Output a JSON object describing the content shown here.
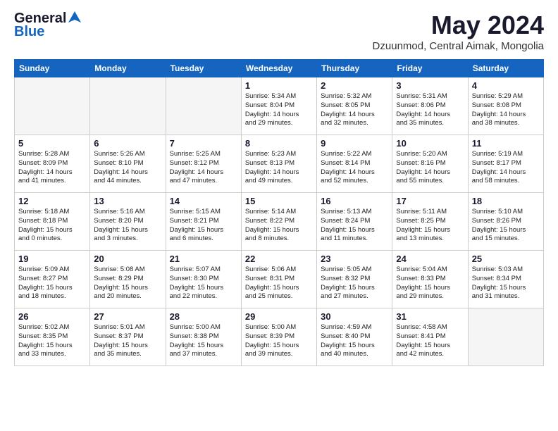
{
  "header": {
    "logo_general": "General",
    "logo_blue": "Blue",
    "month": "May 2024",
    "location": "Dzuunmod, Central Aimak, Mongolia"
  },
  "days_of_week": [
    "Sunday",
    "Monday",
    "Tuesday",
    "Wednesday",
    "Thursday",
    "Friday",
    "Saturday"
  ],
  "weeks": [
    [
      {
        "date": "",
        "info": ""
      },
      {
        "date": "",
        "info": ""
      },
      {
        "date": "",
        "info": ""
      },
      {
        "date": "1",
        "info": "Sunrise: 5:34 AM\nSunset: 8:04 PM\nDaylight: 14 hours\nand 29 minutes."
      },
      {
        "date": "2",
        "info": "Sunrise: 5:32 AM\nSunset: 8:05 PM\nDaylight: 14 hours\nand 32 minutes."
      },
      {
        "date": "3",
        "info": "Sunrise: 5:31 AM\nSunset: 8:06 PM\nDaylight: 14 hours\nand 35 minutes."
      },
      {
        "date": "4",
        "info": "Sunrise: 5:29 AM\nSunset: 8:08 PM\nDaylight: 14 hours\nand 38 minutes."
      }
    ],
    [
      {
        "date": "5",
        "info": "Sunrise: 5:28 AM\nSunset: 8:09 PM\nDaylight: 14 hours\nand 41 minutes."
      },
      {
        "date": "6",
        "info": "Sunrise: 5:26 AM\nSunset: 8:10 PM\nDaylight: 14 hours\nand 44 minutes."
      },
      {
        "date": "7",
        "info": "Sunrise: 5:25 AM\nSunset: 8:12 PM\nDaylight: 14 hours\nand 47 minutes."
      },
      {
        "date": "8",
        "info": "Sunrise: 5:23 AM\nSunset: 8:13 PM\nDaylight: 14 hours\nand 49 minutes."
      },
      {
        "date": "9",
        "info": "Sunrise: 5:22 AM\nSunset: 8:14 PM\nDaylight: 14 hours\nand 52 minutes."
      },
      {
        "date": "10",
        "info": "Sunrise: 5:20 AM\nSunset: 8:16 PM\nDaylight: 14 hours\nand 55 minutes."
      },
      {
        "date": "11",
        "info": "Sunrise: 5:19 AM\nSunset: 8:17 PM\nDaylight: 14 hours\nand 58 minutes."
      }
    ],
    [
      {
        "date": "12",
        "info": "Sunrise: 5:18 AM\nSunset: 8:18 PM\nDaylight: 15 hours\nand 0 minutes."
      },
      {
        "date": "13",
        "info": "Sunrise: 5:16 AM\nSunset: 8:20 PM\nDaylight: 15 hours\nand 3 minutes."
      },
      {
        "date": "14",
        "info": "Sunrise: 5:15 AM\nSunset: 8:21 PM\nDaylight: 15 hours\nand 6 minutes."
      },
      {
        "date": "15",
        "info": "Sunrise: 5:14 AM\nSunset: 8:22 PM\nDaylight: 15 hours\nand 8 minutes."
      },
      {
        "date": "16",
        "info": "Sunrise: 5:13 AM\nSunset: 8:24 PM\nDaylight: 15 hours\nand 11 minutes."
      },
      {
        "date": "17",
        "info": "Sunrise: 5:11 AM\nSunset: 8:25 PM\nDaylight: 15 hours\nand 13 minutes."
      },
      {
        "date": "18",
        "info": "Sunrise: 5:10 AM\nSunset: 8:26 PM\nDaylight: 15 hours\nand 15 minutes."
      }
    ],
    [
      {
        "date": "19",
        "info": "Sunrise: 5:09 AM\nSunset: 8:27 PM\nDaylight: 15 hours\nand 18 minutes."
      },
      {
        "date": "20",
        "info": "Sunrise: 5:08 AM\nSunset: 8:29 PM\nDaylight: 15 hours\nand 20 minutes."
      },
      {
        "date": "21",
        "info": "Sunrise: 5:07 AM\nSunset: 8:30 PM\nDaylight: 15 hours\nand 22 minutes."
      },
      {
        "date": "22",
        "info": "Sunrise: 5:06 AM\nSunset: 8:31 PM\nDaylight: 15 hours\nand 25 minutes."
      },
      {
        "date": "23",
        "info": "Sunrise: 5:05 AM\nSunset: 8:32 PM\nDaylight: 15 hours\nand 27 minutes."
      },
      {
        "date": "24",
        "info": "Sunrise: 5:04 AM\nSunset: 8:33 PM\nDaylight: 15 hours\nand 29 minutes."
      },
      {
        "date": "25",
        "info": "Sunrise: 5:03 AM\nSunset: 8:34 PM\nDaylight: 15 hours\nand 31 minutes."
      }
    ],
    [
      {
        "date": "26",
        "info": "Sunrise: 5:02 AM\nSunset: 8:35 PM\nDaylight: 15 hours\nand 33 minutes."
      },
      {
        "date": "27",
        "info": "Sunrise: 5:01 AM\nSunset: 8:37 PM\nDaylight: 15 hours\nand 35 minutes."
      },
      {
        "date": "28",
        "info": "Sunrise: 5:00 AM\nSunset: 8:38 PM\nDaylight: 15 hours\nand 37 minutes."
      },
      {
        "date": "29",
        "info": "Sunrise: 5:00 AM\nSunset: 8:39 PM\nDaylight: 15 hours\nand 39 minutes."
      },
      {
        "date": "30",
        "info": "Sunrise: 4:59 AM\nSunset: 8:40 PM\nDaylight: 15 hours\nand 40 minutes."
      },
      {
        "date": "31",
        "info": "Sunrise: 4:58 AM\nSunset: 8:41 PM\nDaylight: 15 hours\nand 42 minutes."
      },
      {
        "date": "",
        "info": ""
      }
    ]
  ]
}
